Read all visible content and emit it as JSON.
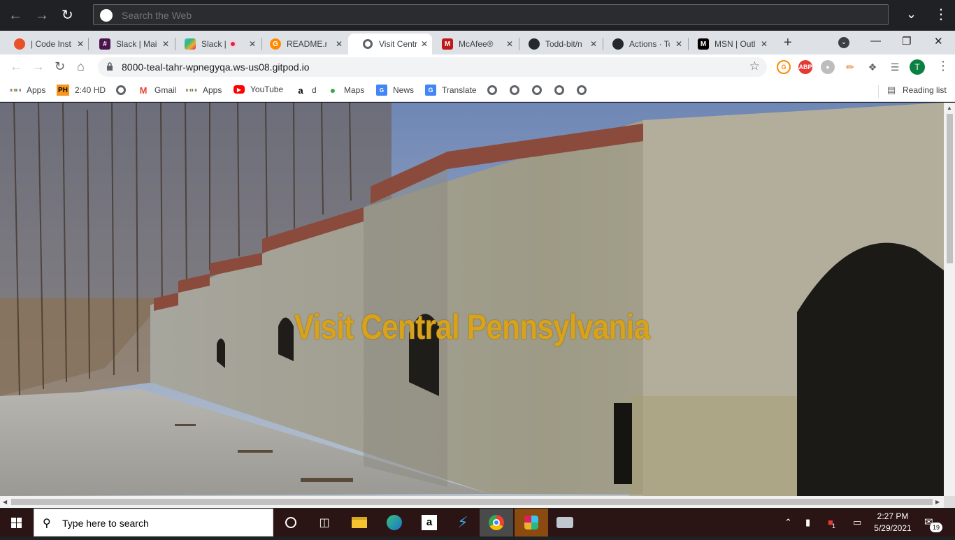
{
  "websearch": {
    "placeholder": "Search the Web"
  },
  "tabs": [
    {
      "label": "| Code Inst",
      "icon": "code-institute-icon",
      "color": "#e8502a"
    },
    {
      "label": "Slack | Mai",
      "icon": "slack-icon",
      "color": "#4a154b"
    },
    {
      "label": "Slack |",
      "icon": "slack-icon",
      "color": "#e01e5a"
    },
    {
      "label": "README.m",
      "icon": "gitpod-icon",
      "color": "#ff8a00"
    },
    {
      "label": "Visit Centr",
      "icon": "globe-icon",
      "color": "#5f6368"
    },
    {
      "label": "McAfee®",
      "icon": "mcafee-icon",
      "color": "#c01818"
    },
    {
      "label": "Todd-bit/n",
      "icon": "github-icon",
      "color": "#24292e"
    },
    {
      "label": "Actions · To",
      "icon": "github-icon",
      "color": "#24292e"
    },
    {
      "label": "MSN | Outl",
      "icon": "msn-icon",
      "color": "#000000"
    }
  ],
  "address": {
    "url": "8000-teal-tahr-wpnegyqa.ws-us08.gitpod.io"
  },
  "profile": {
    "initial": "T"
  },
  "extensions": {
    "abp": "ABP"
  },
  "bookmarks": [
    {
      "label": "Apps",
      "icon": "apps-grid-icon"
    },
    {
      "label": "2:40 HD",
      "icon": "ph-icon",
      "badge": "PH"
    },
    {
      "label": "",
      "icon": "globe-icon"
    },
    {
      "label": "Gmail",
      "icon": "gmail-icon"
    },
    {
      "label": "Apps",
      "icon": "apps-grid-icon"
    },
    {
      "label": "YouTube",
      "icon": "youtube-icon"
    },
    {
      "label": "d",
      "icon": "amazon-icon"
    },
    {
      "label": "Maps",
      "icon": "maps-icon"
    },
    {
      "label": "News",
      "icon": "news-icon"
    },
    {
      "label": "Translate",
      "icon": "translate-icon"
    }
  ],
  "reading_list": "Reading list",
  "page": {
    "hero_title": "Visit Central Pennsylvania",
    "title_color": "#d8a21a"
  },
  "taskbar": {
    "search_placeholder": "Type here to search",
    "time": "2:27 PM",
    "date": "5/29/2021",
    "notifications": "19",
    "tray_badge": "1"
  }
}
